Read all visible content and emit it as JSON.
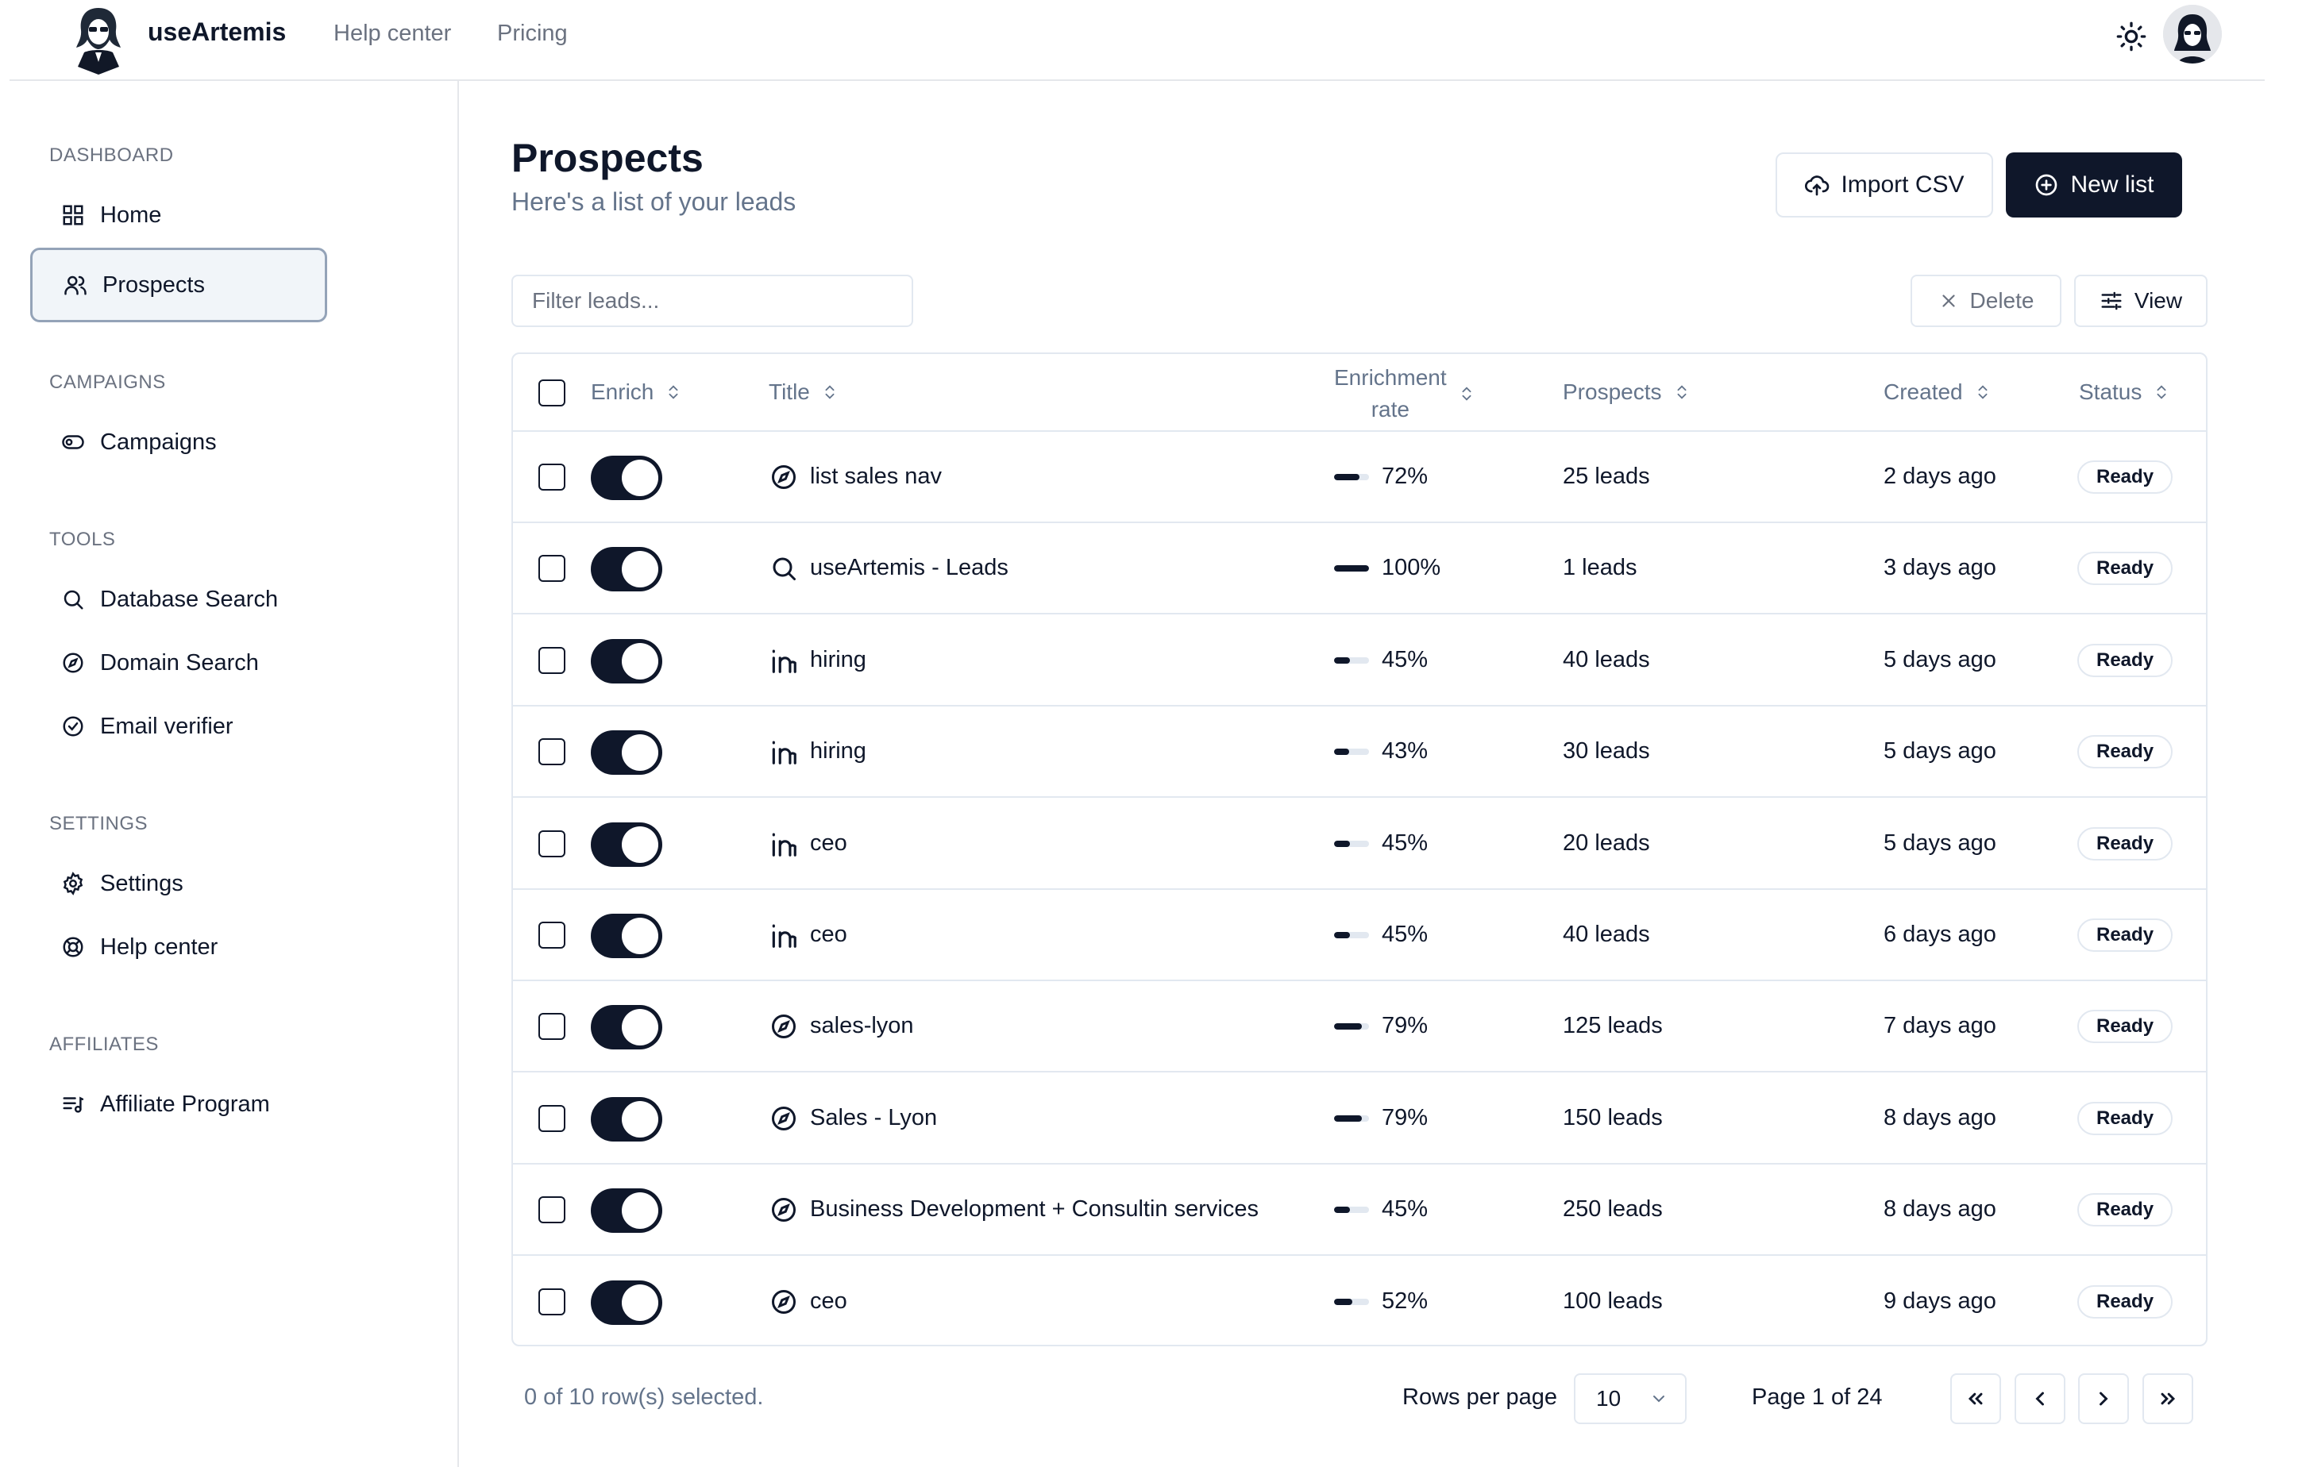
{
  "header": {
    "brand": "useArtemis",
    "nav": [
      "Help center",
      "Pricing"
    ]
  },
  "sidebar": {
    "sections": [
      {
        "label": "DASHBOARD",
        "items": [
          {
            "label": "Home",
            "icon": "grid-icon"
          },
          {
            "label": "Prospects",
            "icon": "users-icon",
            "active": true
          }
        ]
      },
      {
        "label": "CAMPAIGNS",
        "items": [
          {
            "label": "Campaigns",
            "icon": "toggle-icon"
          }
        ]
      },
      {
        "label": "TOOLS",
        "items": [
          {
            "label": "Database Search",
            "icon": "search-icon"
          },
          {
            "label": "Domain Search",
            "icon": "compass-icon"
          },
          {
            "label": "Email verifier",
            "icon": "check-circle-icon"
          }
        ]
      },
      {
        "label": "SETTINGS",
        "items": [
          {
            "label": "Settings",
            "icon": "gear-icon"
          },
          {
            "label": "Help center",
            "icon": "lifebuoy-icon"
          }
        ]
      },
      {
        "label": "AFFILIATES",
        "items": [
          {
            "label": "Affiliate Program",
            "icon": "list-music-icon"
          }
        ]
      }
    ]
  },
  "main": {
    "title": "Prospects",
    "subtitle": "Here's a list of your leads",
    "import_label": "Import CSV",
    "new_list_label": "New list",
    "filter_placeholder": "Filter leads...",
    "delete_label": "Delete",
    "view_label": "View"
  },
  "table": {
    "columns": {
      "enrich": "Enrich",
      "title": "Title",
      "enrichment_rate_1": "Enrichment",
      "enrichment_rate_2": "rate",
      "prospects": "Prospects",
      "created": "Created",
      "status": "Status"
    },
    "rows": [
      {
        "icon": "compass-icon",
        "title": "list sales nav",
        "rate": 72,
        "rate_label": "72%",
        "prospects": "25 leads",
        "created": "2 days ago",
        "status": "Ready"
      },
      {
        "icon": "search-icon",
        "title": "useArtemis - Leads",
        "rate": 100,
        "rate_label": "100%",
        "prospects": "1 leads",
        "created": "3 days ago",
        "status": "Ready"
      },
      {
        "icon": "linkedin-icon",
        "title": "hiring",
        "rate": 45,
        "rate_label": "45%",
        "prospects": "40 leads",
        "created": "5 days ago",
        "status": "Ready"
      },
      {
        "icon": "linkedin-icon",
        "title": "hiring",
        "rate": 43,
        "rate_label": "43%",
        "prospects": "30 leads",
        "created": "5 days ago",
        "status": "Ready"
      },
      {
        "icon": "linkedin-icon",
        "title": "ceo",
        "rate": 45,
        "rate_label": "45%",
        "prospects": "20 leads",
        "created": "5 days ago",
        "status": "Ready"
      },
      {
        "icon": "linkedin-icon",
        "title": "ceo",
        "rate": 45,
        "rate_label": "45%",
        "prospects": "40 leads",
        "created": "6 days ago",
        "status": "Ready"
      },
      {
        "icon": "compass-icon",
        "title": "sales-lyon",
        "rate": 79,
        "rate_label": "79%",
        "prospects": "125 leads",
        "created": "7 days ago",
        "status": "Ready"
      },
      {
        "icon": "compass-icon",
        "title": "Sales - Lyon",
        "rate": 79,
        "rate_label": "79%",
        "prospects": "150 leads",
        "created": "8 days ago",
        "status": "Ready"
      },
      {
        "icon": "compass-icon",
        "title": "Business Development + Consultin services",
        "rate": 45,
        "rate_label": "45%",
        "prospects": "250 leads",
        "created": "8 days ago",
        "status": "Ready"
      },
      {
        "icon": "compass-icon",
        "title": "ceo",
        "rate": 52,
        "rate_label": "52%",
        "prospects": "100 leads",
        "created": "9 days ago",
        "status": "Ready"
      }
    ]
  },
  "footer": {
    "selection": "0 of 10 row(s) selected.",
    "rows_per_page_label": "Rows per page",
    "rows_per_page_value": "10",
    "page_info": "Page 1 of 24"
  },
  "colors": {
    "primary": "#0f172a",
    "muted": "#64748b",
    "border": "#e2e8f0"
  }
}
